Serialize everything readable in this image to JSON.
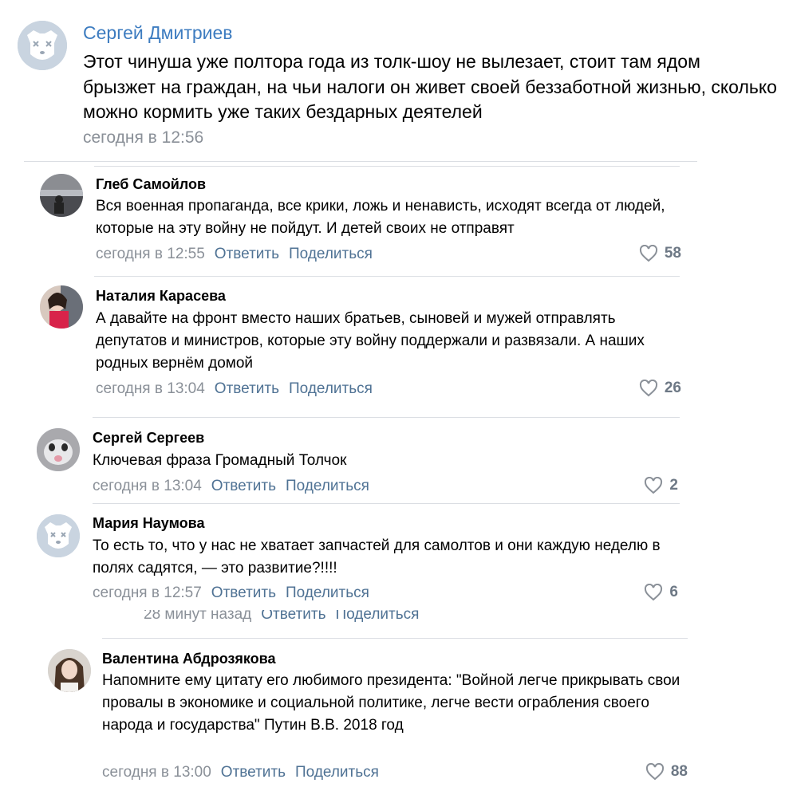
{
  "post": {
    "author": "Сергей Дмитриев",
    "text": "Этот чинуша уже полтора года из толк-шоу не вылезает, стоит там ядом брызжет на граждан, на чьи налоги он живет своей беззаботной жизнью, сколько можно кормить уже таких бездарных деятелей",
    "date": "сегодня в 12:56",
    "avatar": "default-dog-avatar"
  },
  "actions": {
    "reply": "Ответить",
    "share": "Поделиться"
  },
  "comments": [
    {
      "author": "Глеб Самойлов",
      "text": "Вся военная пропаганда, все крики, ложь и ненависть, исходят всегда от людей, которые на эту войну не пойдут. И детей своих не отправят",
      "date": "сегодня в 12:55",
      "likes": "58",
      "avatar": "photo-avatar-landscape"
    },
    {
      "author": "Наталия Карасева",
      "text": "А давайте на фронт вместо наших братьев, сыновей и мужей отправлять депутатов и министров, которые эту войну поддержали и развязали. А наших родных вернём домой",
      "date": "сегодня в 13:04",
      "likes": "26",
      "avatar": "photo-avatar-woman"
    },
    {
      "author": "Сергей Сергеев",
      "text": "Ключевая фраза Громадный Толчок",
      "date": "сегодня в 13:04",
      "likes": "2",
      "avatar": "photo-avatar-cat"
    },
    {
      "author": "Мария Наумова",
      "text": "То есть то, что у нас не хватает запчастей для самолтов и они каждую неделю в полях садятся, — это развитие?!!!!",
      "date": "сегодня в 12:57",
      "likes": "6",
      "avatar": "default-dog-avatar"
    },
    {
      "author": "Валентина Абдрозякова",
      "text": "Напомните ему цитату его любимого президента: \"Войной легче прикрывать свои провалы в экономике и социальной политике, легче вести ограбления своего народа и государства\" Путин В.В. 2018 год",
      "date": "сегодня в 13:00",
      "likes": "88",
      "avatar": "photo-avatar-girl"
    }
  ],
  "ghost_row": {
    "date": "28 минут назад"
  },
  "colors": {
    "author_link": "#3d7cc0",
    "meta_gray": "#8a9098",
    "action_blue": "#4f7294",
    "divider": "#dbdee3",
    "like_gray": "#6d7885"
  },
  "icons": {
    "like": "heart-icon"
  }
}
